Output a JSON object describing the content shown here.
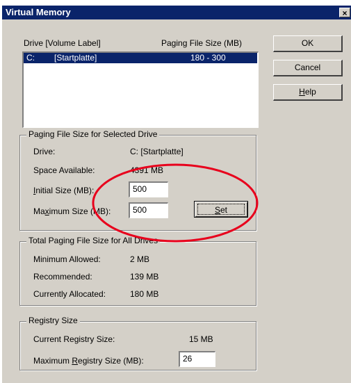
{
  "window": {
    "title": "Virtual Memory",
    "close_label": "×"
  },
  "drives": {
    "header_drive": "Drive  [Volume Label]",
    "header_size": "Paging File Size (MB)",
    "rows": [
      {
        "drive": "C:",
        "label": "[Startplatte]",
        "size": "180 - 300"
      }
    ]
  },
  "buttons": {
    "ok": "OK",
    "cancel": "Cancel",
    "help_pre": "",
    "help_u": "H",
    "help_post": "elp"
  },
  "selected": {
    "legend": "Paging File Size for Selected Drive",
    "drive_label": "Drive:",
    "drive_value": "C:  [Startplatte]",
    "space_label": "Space Available:",
    "space_value": "4391 MB",
    "initial_u": "I",
    "initial_rest": "nitial Size (MB):",
    "initial_value": "500",
    "max_pre": "Ma",
    "max_u": "x",
    "max_rest": "imum Size (MB):",
    "max_value": "500",
    "set_u": "S",
    "set_rest": "et"
  },
  "total": {
    "legend": "Total Paging File Size for All Drives",
    "min_label": "Minimum Allowed:",
    "min_value": "2 MB",
    "rec_label": "Recommended:",
    "rec_value": "139 MB",
    "cur_label": "Currently Allocated:",
    "cur_value": "180 MB"
  },
  "registry": {
    "legend": "Registry Size",
    "current_label": "Current Registry Size:",
    "current_value": "15 MB",
    "max_pre": "Maximum ",
    "max_u": "R",
    "max_rest": "egistry Size (MB):",
    "max_value": "26"
  },
  "annotation": {
    "color": "#e8001c"
  }
}
